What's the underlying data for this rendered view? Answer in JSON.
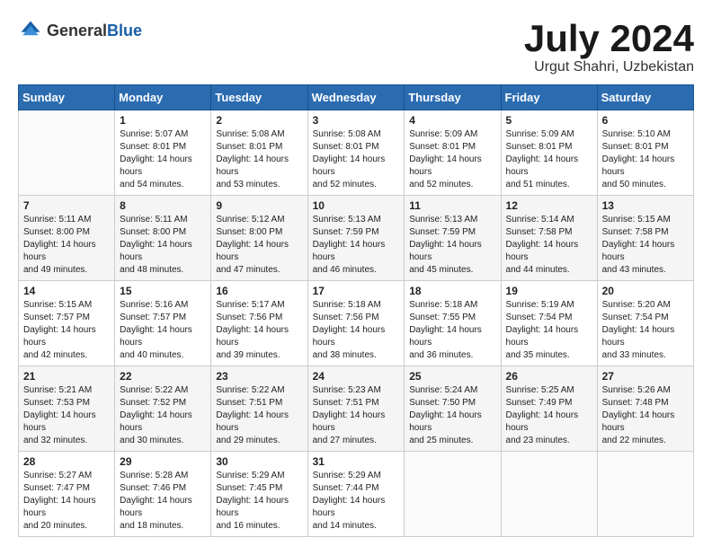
{
  "header": {
    "logo_general": "General",
    "logo_blue": "Blue",
    "month_title": "July 2024",
    "location": "Urgut Shahri, Uzbekistan"
  },
  "days_of_week": [
    "Sunday",
    "Monday",
    "Tuesday",
    "Wednesday",
    "Thursday",
    "Friday",
    "Saturday"
  ],
  "weeks": [
    [
      {
        "day": "",
        "sunrise": "",
        "sunset": "",
        "daylight": ""
      },
      {
        "day": "1",
        "sunrise": "Sunrise: 5:07 AM",
        "sunset": "Sunset: 8:01 PM",
        "daylight": "Daylight: 14 hours and 54 minutes."
      },
      {
        "day": "2",
        "sunrise": "Sunrise: 5:08 AM",
        "sunset": "Sunset: 8:01 PM",
        "daylight": "Daylight: 14 hours and 53 minutes."
      },
      {
        "day": "3",
        "sunrise": "Sunrise: 5:08 AM",
        "sunset": "Sunset: 8:01 PM",
        "daylight": "Daylight: 14 hours and 52 minutes."
      },
      {
        "day": "4",
        "sunrise": "Sunrise: 5:09 AM",
        "sunset": "Sunset: 8:01 PM",
        "daylight": "Daylight: 14 hours and 52 minutes."
      },
      {
        "day": "5",
        "sunrise": "Sunrise: 5:09 AM",
        "sunset": "Sunset: 8:01 PM",
        "daylight": "Daylight: 14 hours and 51 minutes."
      },
      {
        "day": "6",
        "sunrise": "Sunrise: 5:10 AM",
        "sunset": "Sunset: 8:01 PM",
        "daylight": "Daylight: 14 hours and 50 minutes."
      }
    ],
    [
      {
        "day": "7",
        "sunrise": "Sunrise: 5:11 AM",
        "sunset": "Sunset: 8:00 PM",
        "daylight": "Daylight: 14 hours and 49 minutes."
      },
      {
        "day": "8",
        "sunrise": "Sunrise: 5:11 AM",
        "sunset": "Sunset: 8:00 PM",
        "daylight": "Daylight: 14 hours and 48 minutes."
      },
      {
        "day": "9",
        "sunrise": "Sunrise: 5:12 AM",
        "sunset": "Sunset: 8:00 PM",
        "daylight": "Daylight: 14 hours and 47 minutes."
      },
      {
        "day": "10",
        "sunrise": "Sunrise: 5:13 AM",
        "sunset": "Sunset: 7:59 PM",
        "daylight": "Daylight: 14 hours and 46 minutes."
      },
      {
        "day": "11",
        "sunrise": "Sunrise: 5:13 AM",
        "sunset": "Sunset: 7:59 PM",
        "daylight": "Daylight: 14 hours and 45 minutes."
      },
      {
        "day": "12",
        "sunrise": "Sunrise: 5:14 AM",
        "sunset": "Sunset: 7:58 PM",
        "daylight": "Daylight: 14 hours and 44 minutes."
      },
      {
        "day": "13",
        "sunrise": "Sunrise: 5:15 AM",
        "sunset": "Sunset: 7:58 PM",
        "daylight": "Daylight: 14 hours and 43 minutes."
      }
    ],
    [
      {
        "day": "14",
        "sunrise": "Sunrise: 5:15 AM",
        "sunset": "Sunset: 7:57 PM",
        "daylight": "Daylight: 14 hours and 42 minutes."
      },
      {
        "day": "15",
        "sunrise": "Sunrise: 5:16 AM",
        "sunset": "Sunset: 7:57 PM",
        "daylight": "Daylight: 14 hours and 40 minutes."
      },
      {
        "day": "16",
        "sunrise": "Sunrise: 5:17 AM",
        "sunset": "Sunset: 7:56 PM",
        "daylight": "Daylight: 14 hours and 39 minutes."
      },
      {
        "day": "17",
        "sunrise": "Sunrise: 5:18 AM",
        "sunset": "Sunset: 7:56 PM",
        "daylight": "Daylight: 14 hours and 38 minutes."
      },
      {
        "day": "18",
        "sunrise": "Sunrise: 5:18 AM",
        "sunset": "Sunset: 7:55 PM",
        "daylight": "Daylight: 14 hours and 36 minutes."
      },
      {
        "day": "19",
        "sunrise": "Sunrise: 5:19 AM",
        "sunset": "Sunset: 7:54 PM",
        "daylight": "Daylight: 14 hours and 35 minutes."
      },
      {
        "day": "20",
        "sunrise": "Sunrise: 5:20 AM",
        "sunset": "Sunset: 7:54 PM",
        "daylight": "Daylight: 14 hours and 33 minutes."
      }
    ],
    [
      {
        "day": "21",
        "sunrise": "Sunrise: 5:21 AM",
        "sunset": "Sunset: 7:53 PM",
        "daylight": "Daylight: 14 hours and 32 minutes."
      },
      {
        "day": "22",
        "sunrise": "Sunrise: 5:22 AM",
        "sunset": "Sunset: 7:52 PM",
        "daylight": "Daylight: 14 hours and 30 minutes."
      },
      {
        "day": "23",
        "sunrise": "Sunrise: 5:22 AM",
        "sunset": "Sunset: 7:51 PM",
        "daylight": "Daylight: 14 hours and 29 minutes."
      },
      {
        "day": "24",
        "sunrise": "Sunrise: 5:23 AM",
        "sunset": "Sunset: 7:51 PM",
        "daylight": "Daylight: 14 hours and 27 minutes."
      },
      {
        "day": "25",
        "sunrise": "Sunrise: 5:24 AM",
        "sunset": "Sunset: 7:50 PM",
        "daylight": "Daylight: 14 hours and 25 minutes."
      },
      {
        "day": "26",
        "sunrise": "Sunrise: 5:25 AM",
        "sunset": "Sunset: 7:49 PM",
        "daylight": "Daylight: 14 hours and 23 minutes."
      },
      {
        "day": "27",
        "sunrise": "Sunrise: 5:26 AM",
        "sunset": "Sunset: 7:48 PM",
        "daylight": "Daylight: 14 hours and 22 minutes."
      }
    ],
    [
      {
        "day": "28",
        "sunrise": "Sunrise: 5:27 AM",
        "sunset": "Sunset: 7:47 PM",
        "daylight": "Daylight: 14 hours and 20 minutes."
      },
      {
        "day": "29",
        "sunrise": "Sunrise: 5:28 AM",
        "sunset": "Sunset: 7:46 PM",
        "daylight": "Daylight: 14 hours and 18 minutes."
      },
      {
        "day": "30",
        "sunrise": "Sunrise: 5:29 AM",
        "sunset": "Sunset: 7:45 PM",
        "daylight": "Daylight: 14 hours and 16 minutes."
      },
      {
        "day": "31",
        "sunrise": "Sunrise: 5:29 AM",
        "sunset": "Sunset: 7:44 PM",
        "daylight": "Daylight: 14 hours and 14 minutes."
      },
      {
        "day": "",
        "sunrise": "",
        "sunset": "",
        "daylight": ""
      },
      {
        "day": "",
        "sunrise": "",
        "sunset": "",
        "daylight": ""
      },
      {
        "day": "",
        "sunrise": "",
        "sunset": "",
        "daylight": ""
      }
    ]
  ]
}
